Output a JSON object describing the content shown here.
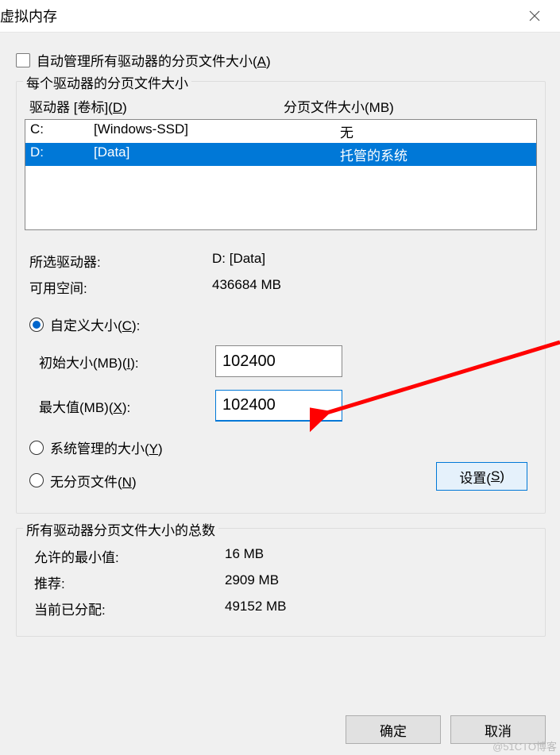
{
  "title": "虚拟内存",
  "checkbox_label_pre": "自动管理所有驱动器的分页文件大小(",
  "checkbox_key": "A",
  "close_paren": ")",
  "group1_legend": "每个驱动器的分页文件大小",
  "drive_hdr_label_pre": "驱动器 [卷标](",
  "drive_hdr_key": "D",
  "size_hdr": "分页文件大小(MB)",
  "drives": [
    {
      "letter": "C:",
      "label": "[Windows-SSD]",
      "value": "无"
    },
    {
      "letter": "D:",
      "label": "[Data]",
      "value": "托管的系统"
    }
  ],
  "selected_drive_label": "所选驱动器:",
  "selected_drive_value": "D:  [Data]",
  "avail_label": "可用空间:",
  "avail_value": "436684 MB",
  "custom_label_pre": "自定义大小(",
  "custom_key": "C",
  "initial_label_pre": "初始大小(MB)(",
  "initial_key": "I",
  "initial_value": "102400",
  "max_label_pre": "最大值(MB)(",
  "max_key": "X",
  "max_value": "102400",
  "sys_managed_pre": "系统管理的大小(",
  "sys_managed_key": "Y",
  "nopage_pre": "无分页文件(",
  "nopage_key": "N",
  "set_btn_pre": "设置(",
  "set_btn_key": "S",
  "totals_legend": "所有驱动器分页文件大小的总数",
  "min_label": "允许的最小值:",
  "min_value": "16 MB",
  "rec_label": "推荐:",
  "rec_value": "2909 MB",
  "cur_label": "当前已分配:",
  "cur_value": "49152 MB",
  "ok": "确定",
  "cancel": "取消",
  "watermark": "@51CTO博客",
  "colon_after": "):"
}
